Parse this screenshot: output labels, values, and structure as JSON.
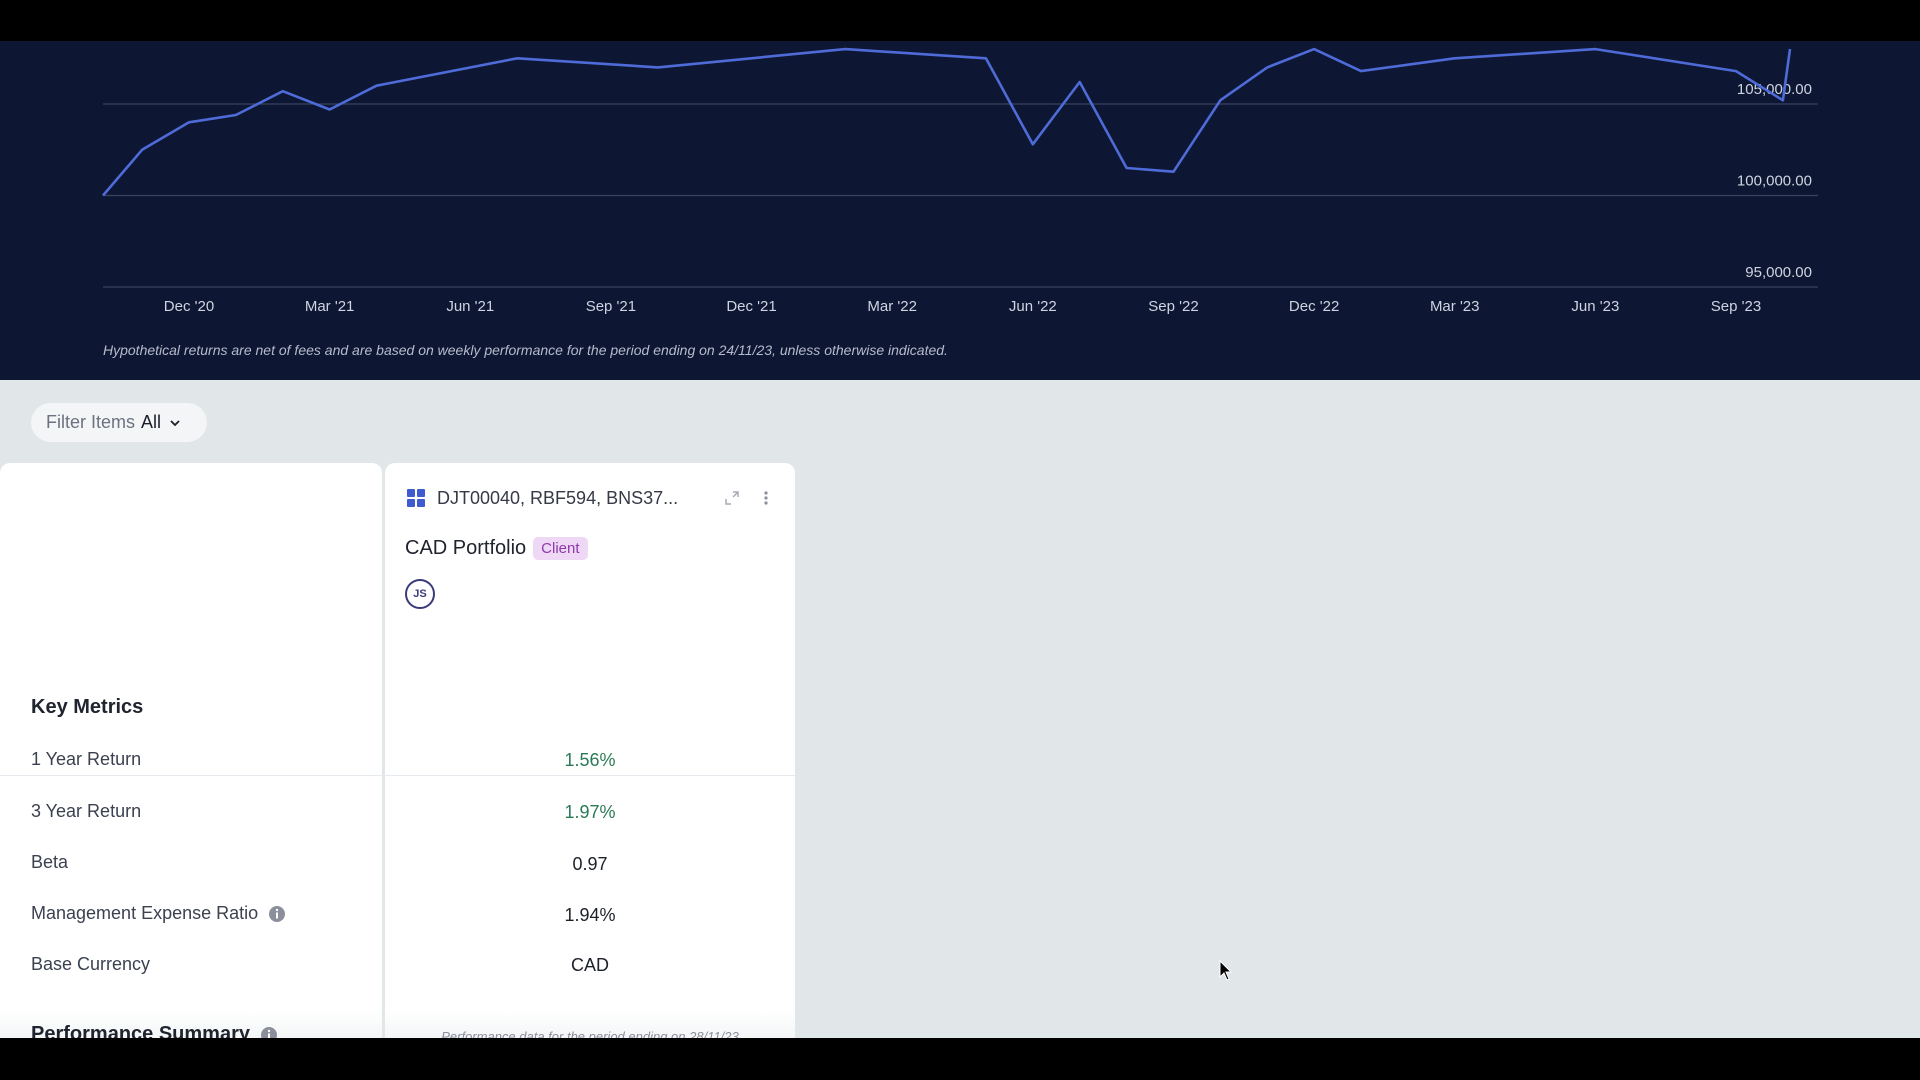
{
  "chart": {
    "y_ticks": [
      "105,000.00",
      "100,000.00",
      "95,000.00"
    ],
    "x_ticks": [
      "Dec '20",
      "Mar '21",
      "Jun '21",
      "Sep '21",
      "Dec '21",
      "Mar '22",
      "Jun '22",
      "Sep '22",
      "Dec '22",
      "Mar '23",
      "Jun '23",
      "Sep '23"
    ],
    "disclaimer": "Hypothetical returns are net of fees and are based on weekly performance for the period ending on 24/11/23, unless otherwise indicated.",
    "line_color": "#4f6bd8"
  },
  "chart_data": {
    "type": "line",
    "ylim": [
      95000,
      106000
    ],
    "x": [
      "2020-10",
      "2020-11",
      "2020-12",
      "2021-01",
      "2021-02",
      "2021-03",
      "2021-04",
      "2021-07",
      "2021-10",
      "2022-02",
      "2022-05",
      "2022-06",
      "2022-07",
      "2022-08",
      "2022-09",
      "2022-10",
      "2022-11",
      "2022-12",
      "2023-01",
      "2023-03",
      "2023-06",
      "2023-09",
      "2023-10",
      "2023-11"
    ],
    "series": [
      {
        "values": [
          100000,
          102500,
          104000,
          104400,
          105700,
          104700,
          106000,
          107500,
          107000,
          108000,
          107500,
          102800,
          106200,
          101500,
          101300,
          105200,
          107000,
          108000,
          106800,
          107500,
          108000,
          106800,
          105200,
          108000
        ]
      }
    ]
  },
  "filter": {
    "label": "Filter Items",
    "value": "All"
  },
  "card": {
    "title": "DJT00040, RBF594, BNS37...",
    "portfolio_name": "CAD Portfolio",
    "badge": "Client",
    "avatar_initials": "JS"
  },
  "key_metrics": {
    "title": "Key Metrics",
    "rows": [
      {
        "label": "1 Year Return",
        "value": "1.56%"
      },
      {
        "label": "3 Year Return",
        "value": "1.97%"
      },
      {
        "label": "Beta",
        "value": "0.97"
      },
      {
        "label": "Management Expense Ratio",
        "value": "1.94%"
      },
      {
        "label": "Base Currency",
        "value": "CAD"
      }
    ]
  },
  "performance_summary": {
    "title": "Performance Summary",
    "note": "Performance data for the period ending on 28/11/23"
  }
}
